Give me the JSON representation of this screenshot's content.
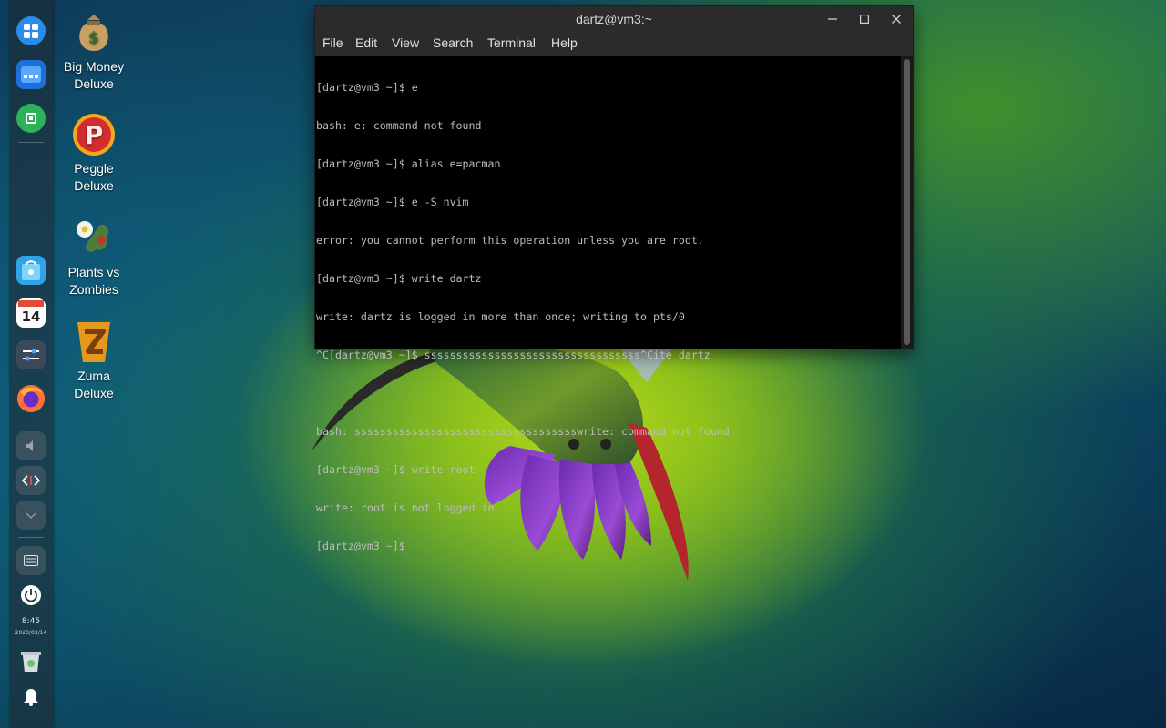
{
  "desktop_icons": [
    {
      "label": "Big Money\nDeluxe",
      "icon": "money-bag-icon"
    },
    {
      "label": "Peggle\nDeluxe",
      "icon": "peggle-icon"
    },
    {
      "label": "Plants vs\nZombies",
      "icon": "plants-vs-zombies-icon"
    },
    {
      "label": "Zuma\nDeluxe",
      "icon": "zuma-icon"
    }
  ],
  "dock": {
    "items": [
      "launcher-icon",
      "file-manager-icon",
      "app-store-icon",
      "app-store-bag-icon",
      "calendar-icon",
      "control-center-icon",
      "firefox-icon",
      "volume-icon",
      "code-switch-icon",
      "collapse-icon",
      "keyboard-icon",
      "power-icon",
      "trash-icon",
      "notification-bell-icon"
    ],
    "calendar_day": "14",
    "time": "8:45",
    "date": "2023/03/14"
  },
  "terminal": {
    "title": "dartz@vm3:~",
    "menu": [
      "File",
      "Edit",
      "View",
      "Search",
      "Terminal",
      "Help"
    ],
    "lines": [
      "[dartz@vm3 ~]$ e",
      "bash: e: command not found",
      "[dartz@vm3 ~]$ alias e=pacman",
      "[dartz@vm3 ~]$ e -S nvim",
      "error: you cannot perform this operation unless you are root.",
      "[dartz@vm3 ~]$ write dartz",
      "write: dartz is logged in more than once; writing to pts/0",
      "^C[dartz@vm3 ~]$ ssssssssssssssssssssssssssssssssss^Cite dartz",
      "",
      "bash: ssssssssssssssssssssssssssssssssssswrite: command not found",
      "[dartz@vm3 ~]$ write root",
      "write: root is not logged in",
      "[dartz@vm3 ~]$ "
    ]
  },
  "colors": {
    "terminal_bg": "#000000",
    "terminal_fg": "#bdbdbd",
    "titlebar_bg": "#2b2b2b"
  }
}
